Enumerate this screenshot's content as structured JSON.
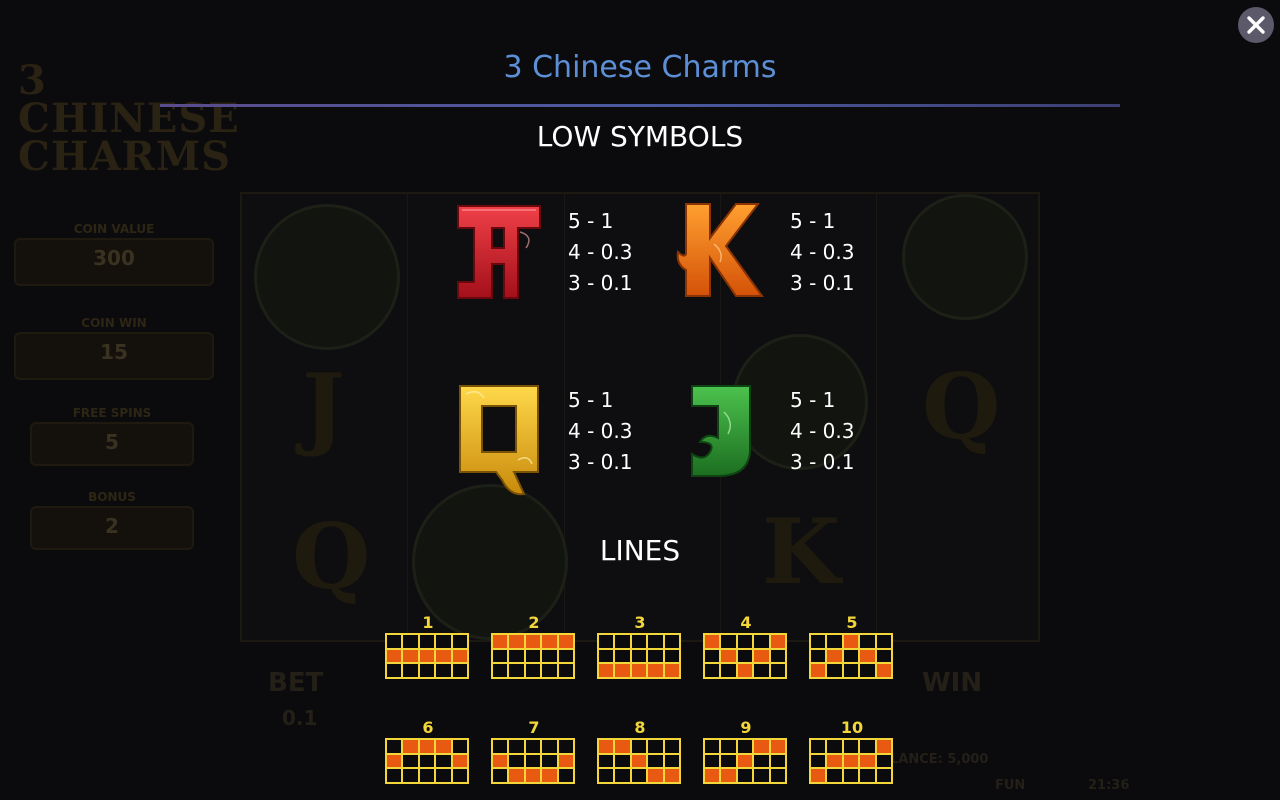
{
  "game": {
    "title": "3 Chinese Charms",
    "close_icon": "close-icon"
  },
  "background": {
    "logo_text": "3 CHINESE CHARMS",
    "panels": [
      {
        "label": "COIN VALUE",
        "value": "300"
      },
      {
        "label": "COIN WIN",
        "value": "15"
      },
      {
        "label": "FREE SPINS",
        "value": "5"
      },
      {
        "label": "BONUS",
        "value": "2"
      }
    ],
    "bet_label": "BET",
    "bet_value": "0.1",
    "win_label": "WIN",
    "balance_text": "BALANCE: 5,000",
    "mode_text": "FUN",
    "clock_text": "21:36"
  },
  "low_symbols": {
    "heading": "LOW SYMBOLS",
    "symbols": [
      {
        "icon": "letter-a-symbol",
        "letter": "A",
        "color": "#d3202a",
        "payouts": [
          "5 - 1",
          "4 - 0.3",
          "3 - 0.1"
        ]
      },
      {
        "icon": "letter-k-symbol",
        "letter": "K",
        "color": "#f07a12",
        "payouts": [
          "5 - 1",
          "4 - 0.3",
          "3 - 0.1"
        ]
      },
      {
        "icon": "letter-q-symbol",
        "letter": "Q",
        "color": "#e9b21a",
        "payouts": [
          "5 - 1",
          "4 - 0.3",
          "3 - 0.1"
        ]
      },
      {
        "icon": "letter-j-symbol",
        "letter": "J",
        "color": "#2f9a36",
        "payouts": [
          "5 - 1",
          "4 - 0.3",
          "3 - 0.1"
        ]
      }
    ]
  },
  "lines": {
    "heading": "LINES",
    "items": [
      {
        "number": "1",
        "rows": [
          1,
          1,
          1,
          1,
          1
        ]
      },
      {
        "number": "2",
        "rows": [
          0,
          0,
          0,
          0,
          0
        ]
      },
      {
        "number": "3",
        "rows": [
          2,
          2,
          2,
          2,
          2
        ]
      },
      {
        "number": "4",
        "rows": [
          0,
          1,
          2,
          1,
          0
        ]
      },
      {
        "number": "5",
        "rows": [
          2,
          1,
          0,
          1,
          2
        ]
      },
      {
        "number": "6",
        "rows": [
          1,
          0,
          0,
          0,
          1
        ]
      },
      {
        "number": "7",
        "rows": [
          1,
          2,
          2,
          2,
          1
        ]
      },
      {
        "number": "8",
        "rows": [
          0,
          0,
          1,
          2,
          2
        ]
      },
      {
        "number": "9",
        "rows": [
          2,
          2,
          1,
          0,
          0
        ]
      },
      {
        "number": "10",
        "rows": [
          2,
          1,
          1,
          1,
          0
        ]
      }
    ]
  }
}
